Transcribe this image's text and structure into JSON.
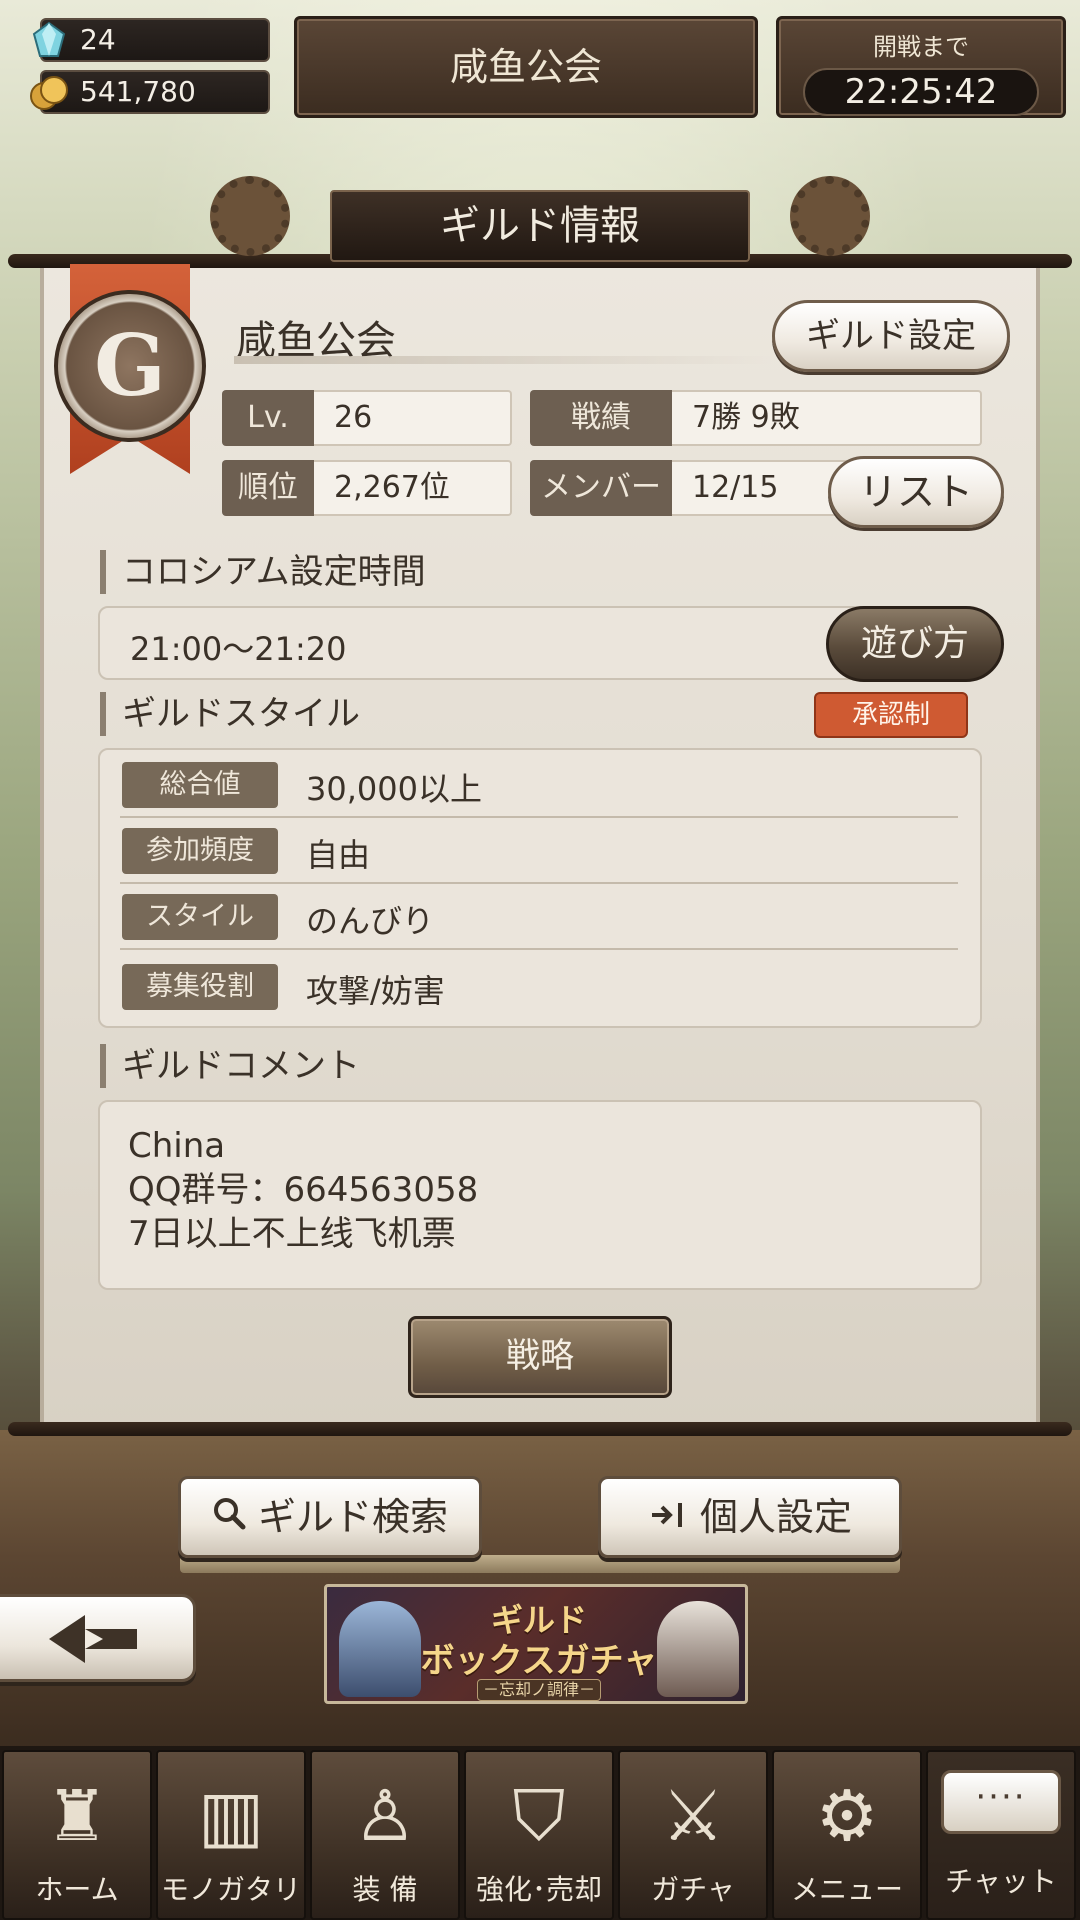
{
  "header": {
    "gems": "24",
    "coins": "541,780",
    "guild_name": "咸鱼公会",
    "timer_label": "開戦まで",
    "timer_value": "22:25:42"
  },
  "panel": {
    "title": "ギルド情報",
    "emblem_letter": "G",
    "guild_name": "咸鱼公会",
    "settings_button": "ギルド設定",
    "stats": {
      "level_label": "Lv.",
      "level_value": "26",
      "record_label": "戦績",
      "record_value": "7勝 9敗",
      "rank_label": "順位",
      "rank_value": "2,267位",
      "members_label": "メンバー",
      "members_value": "12/15"
    },
    "list_button": "リスト",
    "colosseum": {
      "heading": "コロシアム設定時間",
      "time": "21:00〜21:20",
      "howto_button": "遊び方"
    },
    "style": {
      "heading": "ギルドスタイル",
      "badge": "承認制",
      "rows": [
        {
          "label": "総合値",
          "value": "30,000以上"
        },
        {
          "label": "参加頻度",
          "value": "自由"
        },
        {
          "label": "スタイル",
          "value": "のんびり"
        },
        {
          "label": "募集役割",
          "value": "攻撃/妨害"
        }
      ]
    },
    "comment": {
      "heading": "ギルドコメント",
      "lines": [
        "China",
        "QQ群号：664563058",
        "7日以上不上线飞机票"
      ]
    },
    "strategy_button": "戦略"
  },
  "actions": {
    "search": {
      "icon": "search-icon",
      "label": "ギルド検索"
    },
    "personal": {
      "icon": "enter-icon",
      "label": "個人設定"
    },
    "back_icon": "back-arrow-icon"
  },
  "banner": {
    "title_line1": "ギルド",
    "title_line2": "ボックスガチャ",
    "subtitle": "－忘却ノ調律－"
  },
  "nav": [
    {
      "label": "ホーム",
      "icon": "castle-icon"
    },
    {
      "label": "モノガタリ",
      "icon": "book-icon"
    },
    {
      "label": "装 備",
      "icon": "marionette-icon"
    },
    {
      "label": "強化･売却",
      "icon": "shield-icon"
    },
    {
      "label": "ガチャ",
      "icon": "swords-icon"
    },
    {
      "label": "メニュー",
      "icon": "gears-icon"
    },
    {
      "label": "チャット",
      "icon": "chat-bubble-icon",
      "bubble": "····"
    }
  ],
  "colors": {
    "accent_badge": "#cf5a32",
    "panel_bg": "#ece7de",
    "label_bg": "#6d5f51",
    "nav_bg": "#3a2d22"
  }
}
